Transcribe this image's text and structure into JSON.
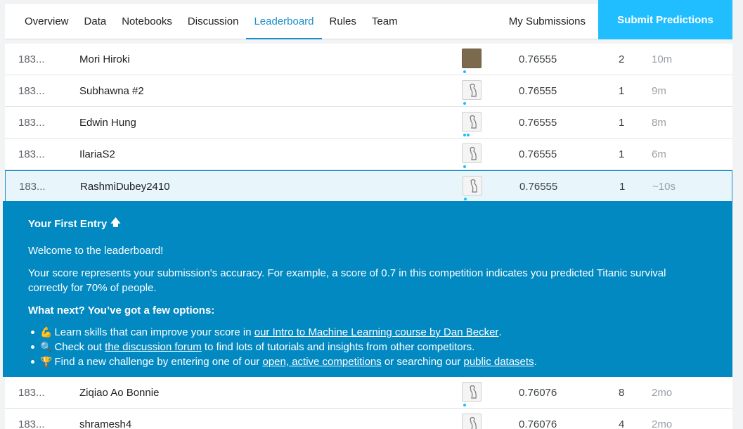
{
  "nav": {
    "tabs": [
      "Overview",
      "Data",
      "Notebooks",
      "Discussion",
      "Leaderboard",
      "Rules",
      "Team"
    ],
    "active_tab": "Leaderboard",
    "my_submissions": "My Submissions",
    "submit_button": "Submit Predictions"
  },
  "rows_top": [
    {
      "rank": "183...",
      "name": "Mori Hiroki",
      "score": "0.76555",
      "entries": "2",
      "last": "10m"
    },
    {
      "rank": "183...",
      "name": "Subhawna #2",
      "score": "0.76555",
      "entries": "1",
      "last": "9m"
    },
    {
      "rank": "183...",
      "name": "Edwin Hung",
      "score": "0.76555",
      "entries": "1",
      "last": "8m"
    },
    {
      "rank": "183...",
      "name": "IlariaS2",
      "score": "0.76555",
      "entries": "1",
      "last": "6m"
    }
  ],
  "highlight_row": {
    "rank": "183...",
    "name": "RashmiDubey2410",
    "score": "0.76555",
    "entries": "1",
    "last": "~10s"
  },
  "panel": {
    "title": "Your First Entry",
    "welcome": "Welcome to the leaderboard!",
    "score_text": "Your score represents your submission's accuracy. For example, a score of 0.7 in this competition indicates you predicted Titanic survival correctly for 70% of people.",
    "next_heading": "What next? You’ve got a few options:",
    "option1_pre": "Learn skills that can improve your score in ",
    "option1_link": "our Intro to Machine Learning course by Dan Becker",
    "option1_post": ".",
    "option2_pre": "Check out ",
    "option2_link": "the discussion forum",
    "option2_post": " to find lots of tutorials and insights from other competitors.",
    "option3_pre": "Find a new challenge by entering one of our ",
    "option3_link": "open, active competitions",
    "option3_mid": " or searching our ",
    "option3_link2": "public datasets",
    "option3_post": "."
  },
  "rows_bottom": [
    {
      "rank": "183...",
      "name": "Ziqiao Ao Bonnie",
      "score": "0.76076",
      "entries": "8",
      "last": "2mo"
    },
    {
      "rank": "183...",
      "name": "shramesh4",
      "score": "0.76076",
      "entries": "4",
      "last": "2mo"
    }
  ]
}
